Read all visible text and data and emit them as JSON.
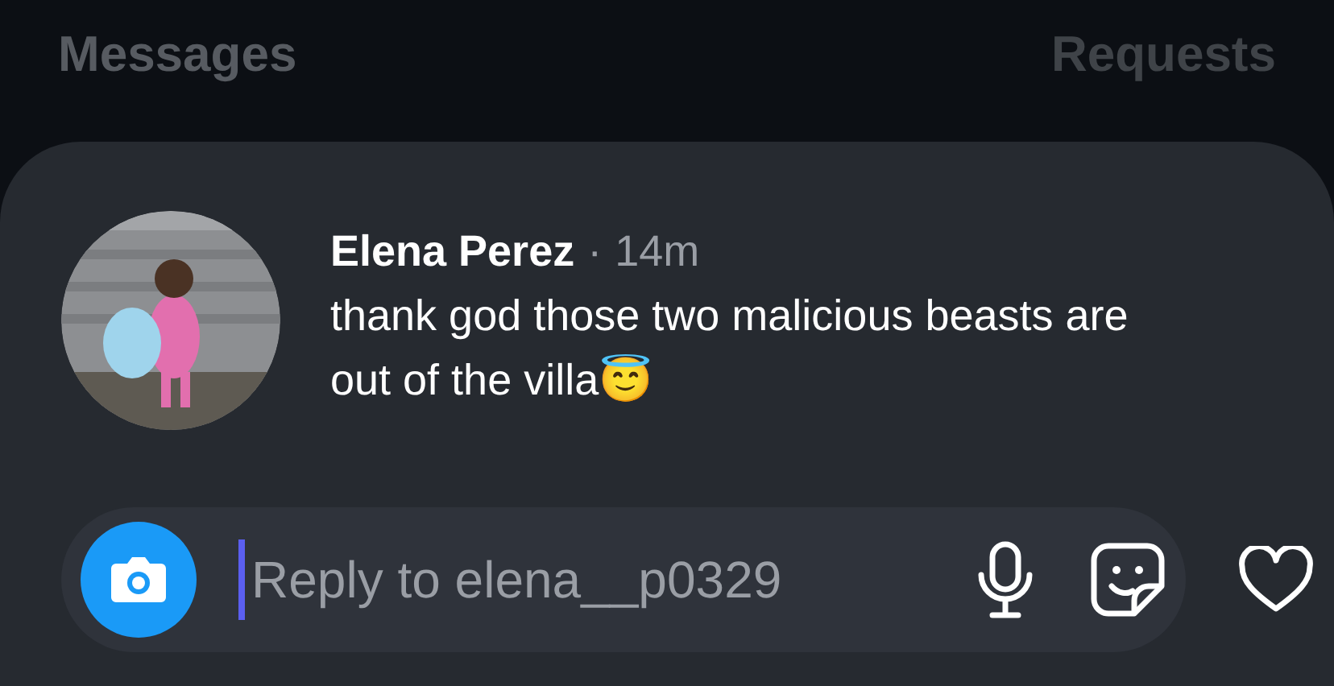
{
  "tabs": [
    {
      "label": "Messages",
      "selected": true
    },
    {
      "label": "Requests",
      "selected": false
    }
  ],
  "message": {
    "sender": "Elena Perez",
    "separator": "·",
    "time": "14m",
    "text": "thank god those two malicious beasts are out of the villa😇"
  },
  "reply_bar": {
    "placeholder": "Reply to elena__p0329"
  }
}
